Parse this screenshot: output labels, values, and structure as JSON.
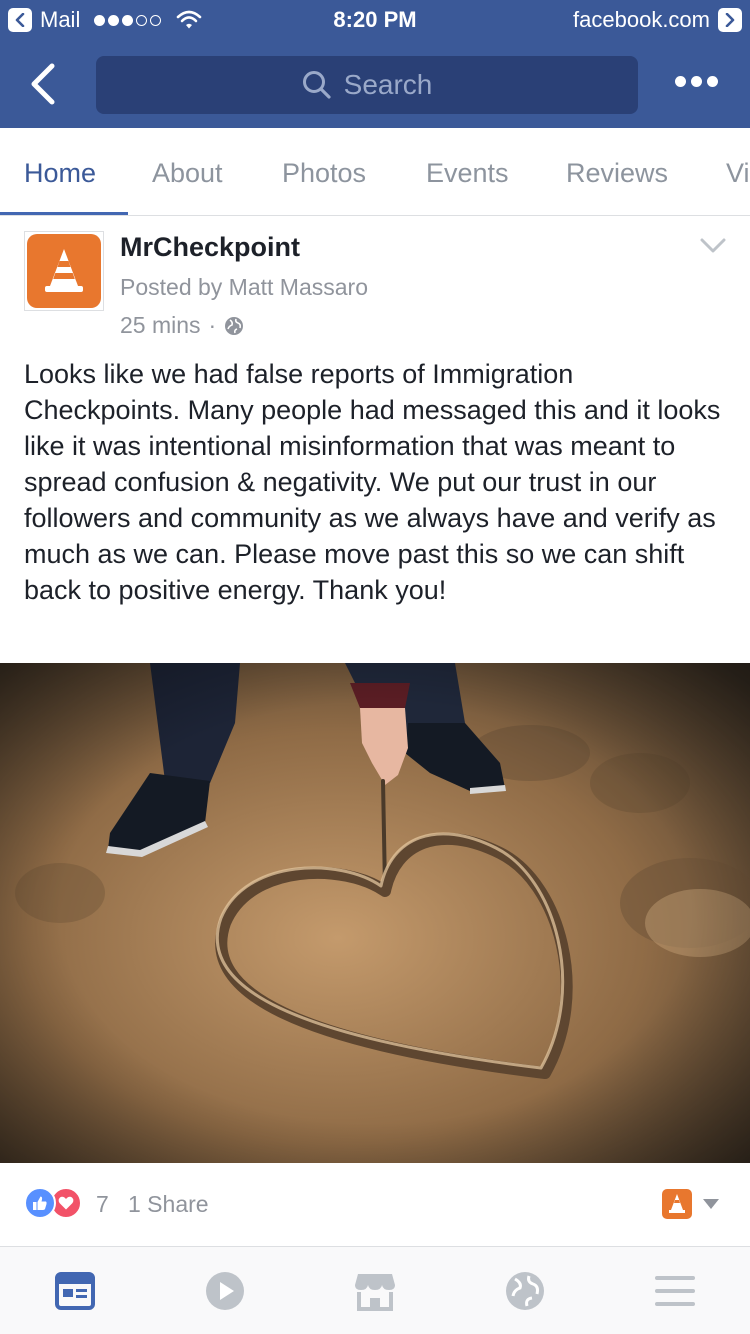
{
  "status_bar": {
    "back_app": "Mail",
    "time": "8:20 PM",
    "domain": "facebook.com"
  },
  "navbar": {
    "search_placeholder": "Search"
  },
  "tabs": [
    {
      "label": "Home",
      "active": true
    },
    {
      "label": "About",
      "active": false
    },
    {
      "label": "Photos",
      "active": false
    },
    {
      "label": "Events",
      "active": false
    },
    {
      "label": "Reviews",
      "active": false
    },
    {
      "label": "Vi",
      "active": false
    }
  ],
  "post": {
    "page_name": "MrCheckpoint",
    "posted_by": "Posted by Matt Massaro",
    "time": "25 mins",
    "separator": "·",
    "text": "Looks like we had false reports of Immigration Checkpoints. Many people had messaged this and it looks like it was intentional misinformation that was meant to spread confusion & negativity. We put our trust in our followers and community as we always have and verify as much as we can. Please move past this so we can shift back to positive energy. Thank you!",
    "reaction_count": "7",
    "share_count": "1 Share"
  },
  "bottom_nav": [
    {
      "icon": "news-feed-icon",
      "active": true
    },
    {
      "icon": "video-play-icon",
      "active": false
    },
    {
      "icon": "marketplace-icon",
      "active": false
    },
    {
      "icon": "globe-icon",
      "active": false
    },
    {
      "icon": "menu-icon",
      "active": false
    }
  ],
  "colors": {
    "brand_blue": "#3b5998",
    "tab_active": "#4267b2",
    "page_avatar": "#e8772e",
    "like_blue": "#5890ff",
    "love_red": "#f25268"
  }
}
